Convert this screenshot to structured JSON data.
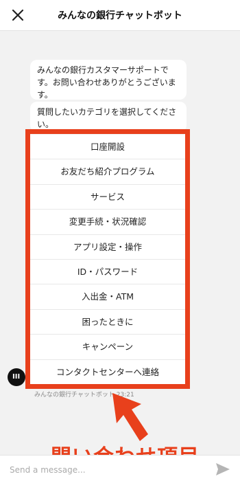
{
  "header": {
    "title": "みんなの銀行チャットボット",
    "close_icon": "close-icon"
  },
  "messages": [
    "みんなの銀行カスタマーサポートです。お問い合わせありがとうございます。",
    "質問したいカテゴリを選択してください。"
  ],
  "menu": {
    "items": [
      "口座開設",
      "お友だち紹介プログラム",
      "サービス",
      "変更手続・状況確認",
      "アプリ設定・操作",
      "ID・パスワード",
      "入出金・ATM",
      "困ったときに",
      "キャンペーン",
      "コンタクトセンターへ連絡"
    ]
  },
  "bot": {
    "avatar_text": "III",
    "caption": "みんなの銀行チャットボット 23:21"
  },
  "annotation": {
    "label": "問い合わせ項目",
    "color": "#e8401c"
  },
  "input": {
    "placeholder": "Send a message...",
    "send_icon": "send-icon"
  }
}
